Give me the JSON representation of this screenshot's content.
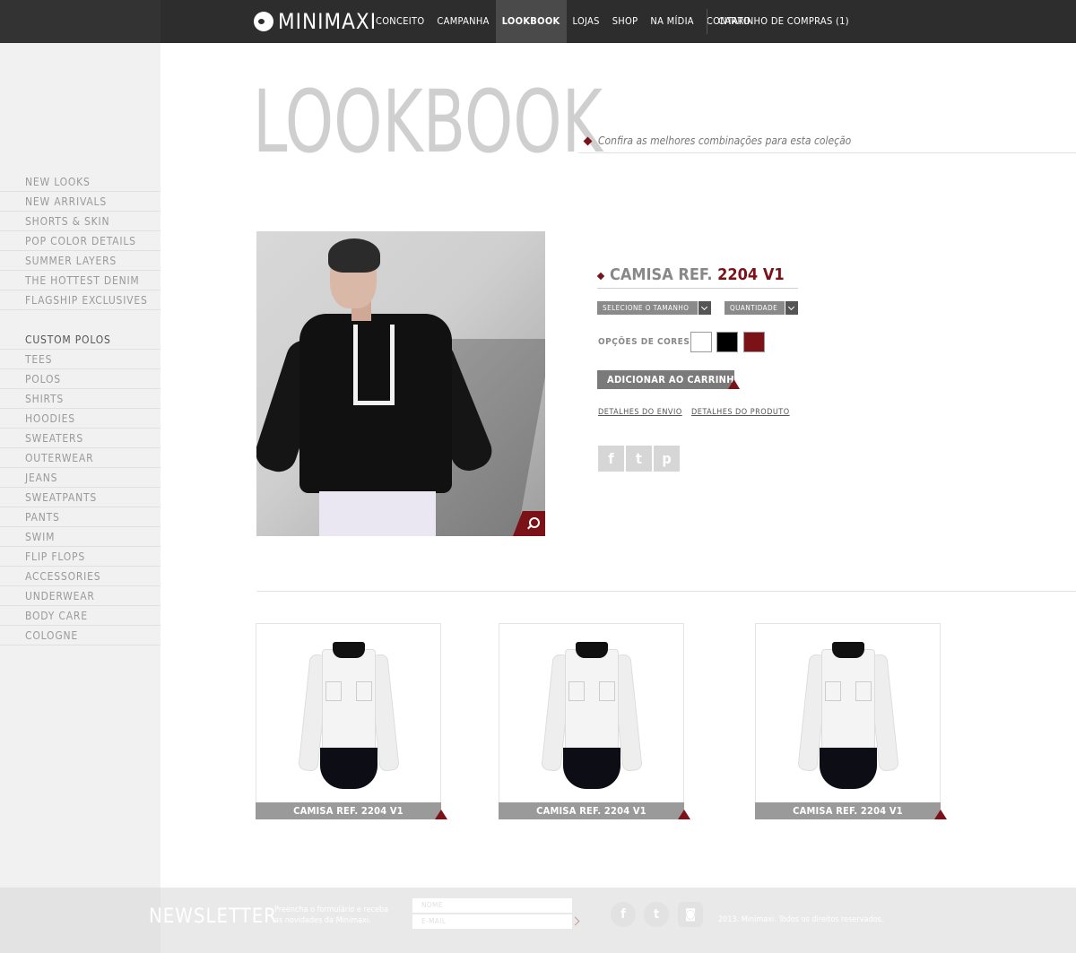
{
  "brand": {
    "logo_mini": "MINI",
    "logo_maxi": "MAXI"
  },
  "nav": {
    "items": [
      "CONCEITO",
      "CAMPANHA",
      "LOOKBOOK",
      "LOJAS",
      "SHOP",
      "NA MÍDIA",
      "CONTATO"
    ],
    "active": "LOOKBOOK",
    "cart": "CARRINHO DE COMPRAS (1)"
  },
  "sidebar": {
    "group1": [
      "NEW LOOKS",
      "NEW ARRIVALS",
      "SHORTS & SKIN",
      "POP COLOR DETAILS",
      "SUMMER LAYERS",
      "THE HOTTEST DENIM",
      "FLAGSHIP EXCLUSIVES"
    ],
    "group2": [
      "CUSTOM POLOS",
      "TEES",
      "POLOS",
      "SHIRTS",
      "HOODIES",
      "SWEATERS",
      "OUTERWEAR",
      "JEANS",
      "SWEATPANTS",
      "PANTS",
      "SWIM",
      "FLIP FLOPS",
      "ACCESSORIES",
      "UNDERWEAR",
      "BODY CARE",
      "COLOGNE"
    ]
  },
  "header": {
    "title": "LOOKBOOK",
    "tagline": "Confira as melhores combinações para esta coleção"
  },
  "product": {
    "title_prefix": "CAMISA REF.",
    "title_code": " 2204 V1",
    "size_placeholder": "SELECIONE O TAMANHO",
    "qty_placeholder": "QUANTIDADE",
    "colors_label": "OPÇÕES DE CORES",
    "colors": [
      "#ffffff",
      "#000000",
      "#7a1218"
    ],
    "add_to_cart": "ADICIONAR AO CARRINHO",
    "shipping_details": "DETALHES DO ENVIO",
    "product_details": "DETALHES DO PRODUTO",
    "social": {
      "facebook": "f",
      "twitter": "t",
      "pinterest": "p"
    }
  },
  "related": [
    {
      "label": "CAMISA REF. 2204 V1"
    },
    {
      "label": "CAMISA REF. 2204 V1"
    },
    {
      "label": "CAMISA REF. 2204 V1"
    }
  ],
  "footer": {
    "newsletter_title": "NEWSLETTER",
    "newsletter_text": "Preencha o formulário e receba as novidades da Minimaxi.",
    "name_placeholder": "NOME",
    "email_placeholder": "E-MAIL",
    "copyright": "2013. Minimaxi. Todos os direitos reservados."
  },
  "colors": {
    "accent": "#7a1218",
    "topbar": "#2d2d2d",
    "sidebar": "#f1f1f1"
  }
}
